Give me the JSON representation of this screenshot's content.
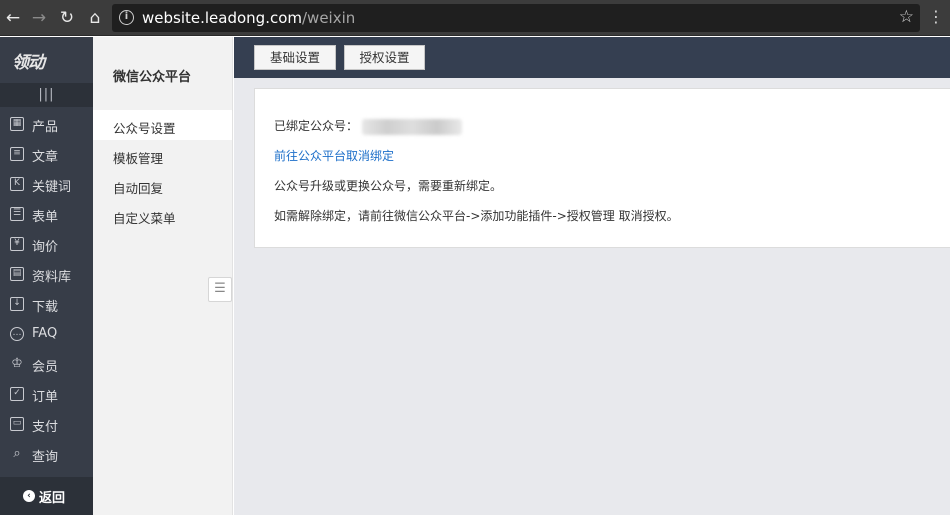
{
  "browser": {
    "url_host": "website.leadong.com",
    "url_path": "/weixin"
  },
  "sidebar": {
    "logo": "领动",
    "collapse": "|||",
    "items": [
      {
        "label": "产品",
        "icon": "grid-icon",
        "glyph": "▦"
      },
      {
        "label": "文章",
        "icon": "article-icon",
        "glyph": "≡"
      },
      {
        "label": "关键词",
        "icon": "keyword-icon",
        "glyph": "K"
      },
      {
        "label": "表单",
        "icon": "form-icon",
        "glyph": "☰"
      },
      {
        "label": "询价",
        "icon": "quote-icon",
        "glyph": "¥"
      },
      {
        "label": "资料库",
        "icon": "library-icon",
        "glyph": "▤"
      },
      {
        "label": "下载",
        "icon": "download-icon",
        "glyph": "↓"
      },
      {
        "label": "FAQ",
        "icon": "faq-icon",
        "glyph": "…"
      },
      {
        "label": "会员",
        "icon": "member-icon",
        "glyph": "♔"
      },
      {
        "label": "订单",
        "icon": "order-icon",
        "glyph": "✓"
      },
      {
        "label": "支付",
        "icon": "payment-icon",
        "glyph": "▭"
      },
      {
        "label": "查询",
        "icon": "search-icon",
        "glyph": "⌕"
      }
    ],
    "back_label": "返回"
  },
  "subnav": {
    "title": "微信公众平台",
    "items": [
      {
        "label": "公众号设置",
        "active": true
      },
      {
        "label": "模板管理",
        "active": false
      },
      {
        "label": "自动回复",
        "active": false
      },
      {
        "label": "自定义菜单",
        "active": false
      }
    ]
  },
  "tabs": [
    {
      "label": "基础设置"
    },
    {
      "label": "授权设置"
    }
  ],
  "panel": {
    "bound_label": "已绑定公众号：",
    "unbind_link": "前往公众平台取消绑定",
    "notice": "公众号升级或更换公众号，需要重新绑定。",
    "instruction": "如需解除绑定，请前往微信公众平台->添加功能插件->授权管理 取消授权。"
  },
  "colors": {
    "sidebar_bg": "#373d48",
    "topbar_bg": "#353f51",
    "link": "#1d6fc9"
  }
}
